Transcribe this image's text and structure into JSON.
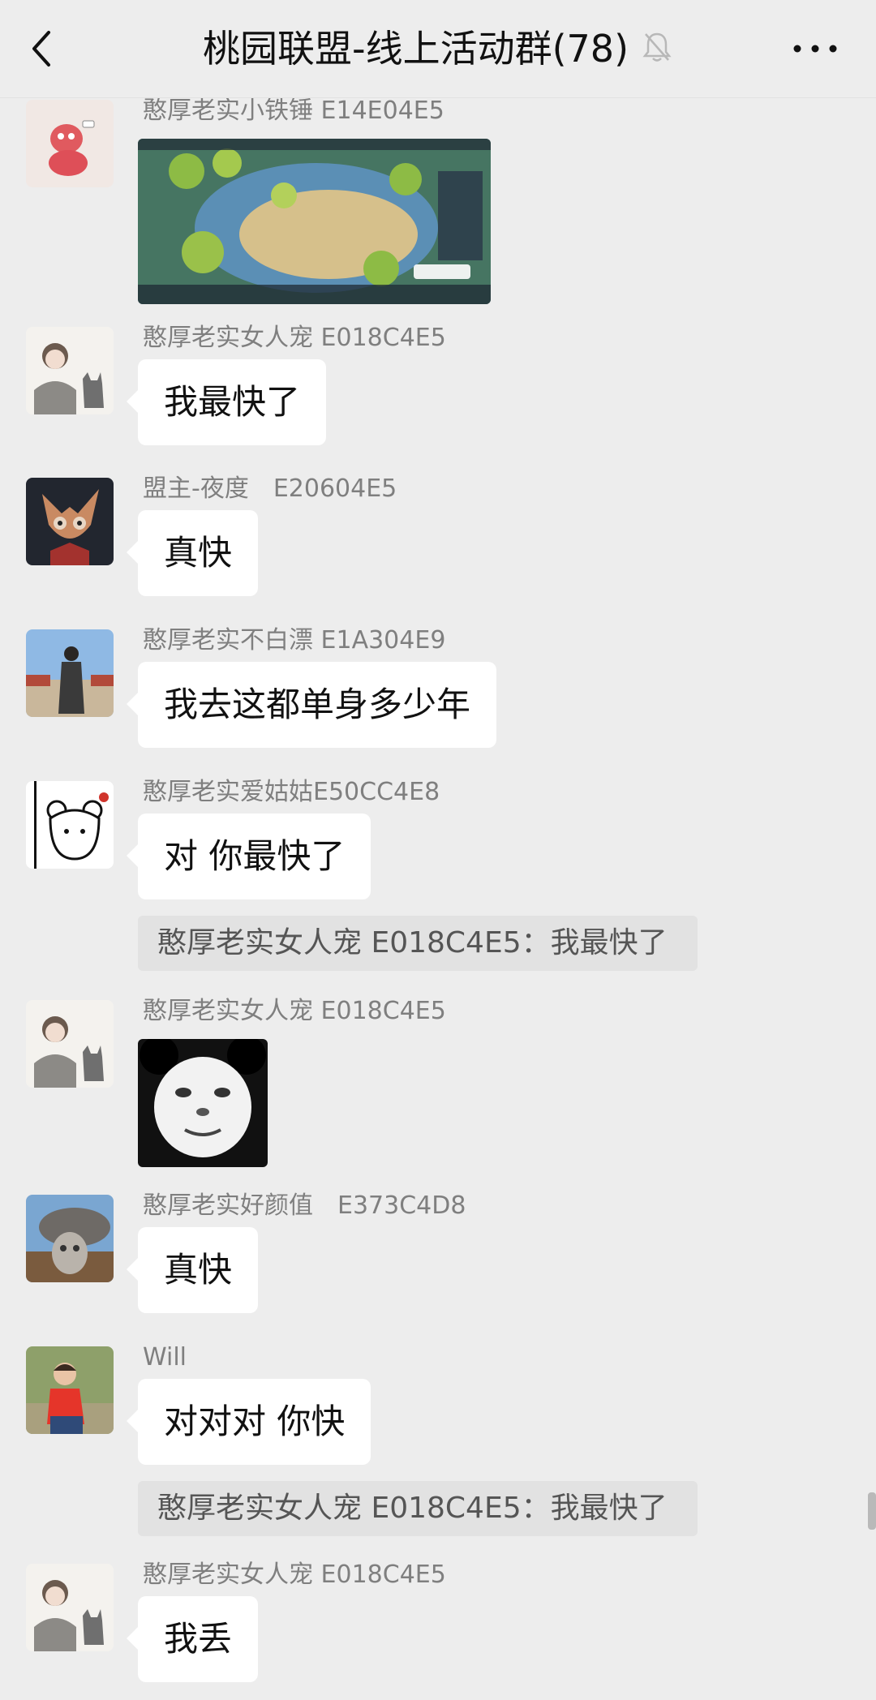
{
  "header": {
    "title": "桃园联盟-线上活动群(78)",
    "back_icon": "chevron-left-icon",
    "mute_icon": "muted-bell-icon",
    "more_icon": "more-dots-icon"
  },
  "messages": [
    {
      "sender": "憨厚老实小铁锤 E14E04E5",
      "type": "image",
      "image": "game-screenshot"
    },
    {
      "sender": "憨厚老实女人宠 E018C4E5",
      "text": "我最快了"
    },
    {
      "sender": "盟主-夜度　E20604E5",
      "text": "真快"
    },
    {
      "sender": "憨厚老实不白漂 E1A304E9",
      "text": "我去这都单身多少年"
    },
    {
      "sender": "憨厚老实爱姑姑E50CC4E8",
      "text": "对 你最快了",
      "quote": "憨厚老实女人宠 E018C4E5：我最快了"
    },
    {
      "sender": "憨厚老实女人宠 E018C4E5",
      "type": "image",
      "image": "panda-meme-sticker"
    },
    {
      "sender": "憨厚老实好颜值　E373C4D8",
      "text": "真快"
    },
    {
      "sender": "Will",
      "text": "对对对 你快",
      "quote": "憨厚老实女人宠 E018C4E5：我最快了"
    },
    {
      "sender": "憨厚老实女人宠 E018C4E5",
      "text": "我丢"
    }
  ],
  "colors": {
    "background": "#ededed",
    "bubble": "#ffffff",
    "quote_bg": "#e2e2e2",
    "sender_text": "#7f7f7f"
  }
}
